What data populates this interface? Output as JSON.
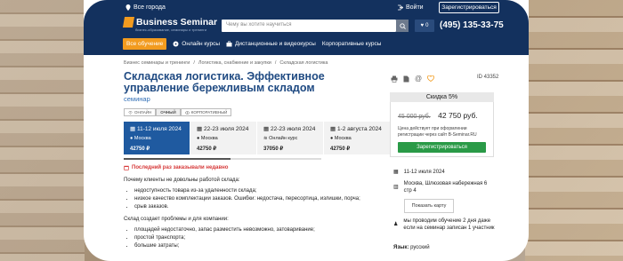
{
  "header": {
    "city": "Все города",
    "login": "Войти",
    "register": "Зарегистрироваться",
    "logo_name": "Business Seminar",
    "logo_sub": "бизнес-образование, семинары и тренинги",
    "search_placeholder": "Чему вы хотите научиться",
    "favorites_count": "0",
    "phone": "(495) 135-33-75",
    "nav": [
      {
        "label": "Все обучение",
        "active": true
      },
      {
        "label": "Онлайн курсы",
        "icon": "play-icon"
      },
      {
        "label": "Дистанционные и видеокурсы",
        "icon": "briefcase-icon"
      },
      {
        "label": "Корпоративные курсы"
      }
    ]
  },
  "breadcrumb": [
    "Бизнес семинары и тренинги",
    "Логистика, снабжение и закупки",
    "Складская логистика"
  ],
  "course": {
    "title": "Складская логистика. Эффективное управление бережливым складом",
    "subtitle": "семинар",
    "id_label": "ID 43352",
    "formats": [
      {
        "label": "ОНЛАЙН",
        "active": false
      },
      {
        "label": "ОЧНЫЙ",
        "active": true
      },
      {
        "label": "КОРПОРАТИВНЫЙ",
        "active": false
      }
    ]
  },
  "sessions": [
    {
      "date": "11-12 июля 2024",
      "place": "Москва",
      "price": "42750 ₽",
      "active": true
    },
    {
      "date": "22-23 июля 2024",
      "place": "Москва",
      "price": "42750 ₽",
      "active": false
    },
    {
      "date": "22-23 июля 2024",
      "place": "Онлайн курс",
      "price": "37050 ₽",
      "active": false
    },
    {
      "date": "1-2 августа 2024",
      "place": "Москва",
      "price": "42750 ₽",
      "active": false
    }
  ],
  "alert": "Последний раз заказывали недавно",
  "description": {
    "intro": "Почему клиенты не довольны работой склада:",
    "reasons": [
      "недоступность товара из-за удаленности склада;",
      "низкое качество комплектации заказов. Ошибки: недостача, пересортица, излишки, порча;",
      "срыв заказов."
    ],
    "intro2": "Склад создает проблемы и для компании:",
    "problems": [
      "площадей недостаточно, запас разместить невозможно, затоваривание;",
      "простой транспорта;",
      "большие затраты;"
    ]
  },
  "sidebar": {
    "discount": "Скидка 5%",
    "old_price": "45 000 руб.",
    "new_price": "42 750 руб.",
    "price_note": "Цена действует при оформлении регистрации через сайт B-Seminar.RU",
    "register_button": "Зарегистрироваться",
    "date": "11-12 июля 2024",
    "address": "Москва, Шлюзовая набережная 6 стр 4",
    "map_button": "Показать карту",
    "learners_note": "мы проводим обучение 2 дня даже если на семинар записан 1 участник",
    "language_label": "Язык:",
    "language_value": "русский"
  }
}
